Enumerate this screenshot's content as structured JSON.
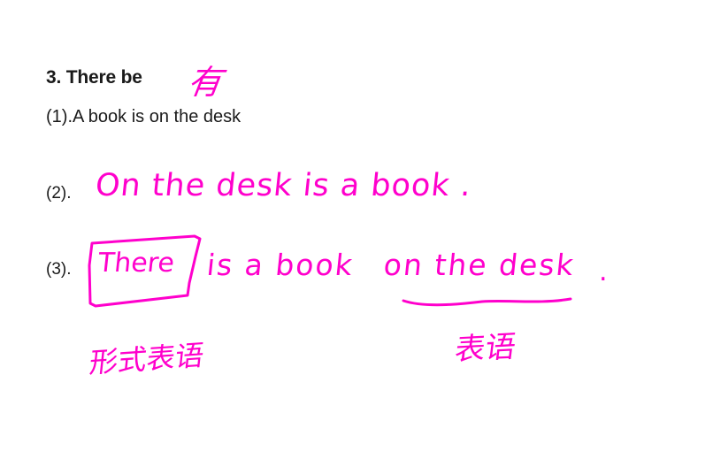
{
  "heading": "3. There be",
  "annotation_you": "有",
  "line1": {
    "number": "(1).",
    "text": "A book is on the desk"
  },
  "line2": {
    "number": "(2).",
    "handwritten": "On the desk is a book ."
  },
  "line3": {
    "number": "(3).",
    "boxed_word": "There",
    "rest": "is a book",
    "underlined_phrase": "on the desk",
    "end_period": "."
  },
  "labels": {
    "formal_subject": "形式表语",
    "predicative": "表语"
  },
  "ink_color": "#ff00cc"
}
